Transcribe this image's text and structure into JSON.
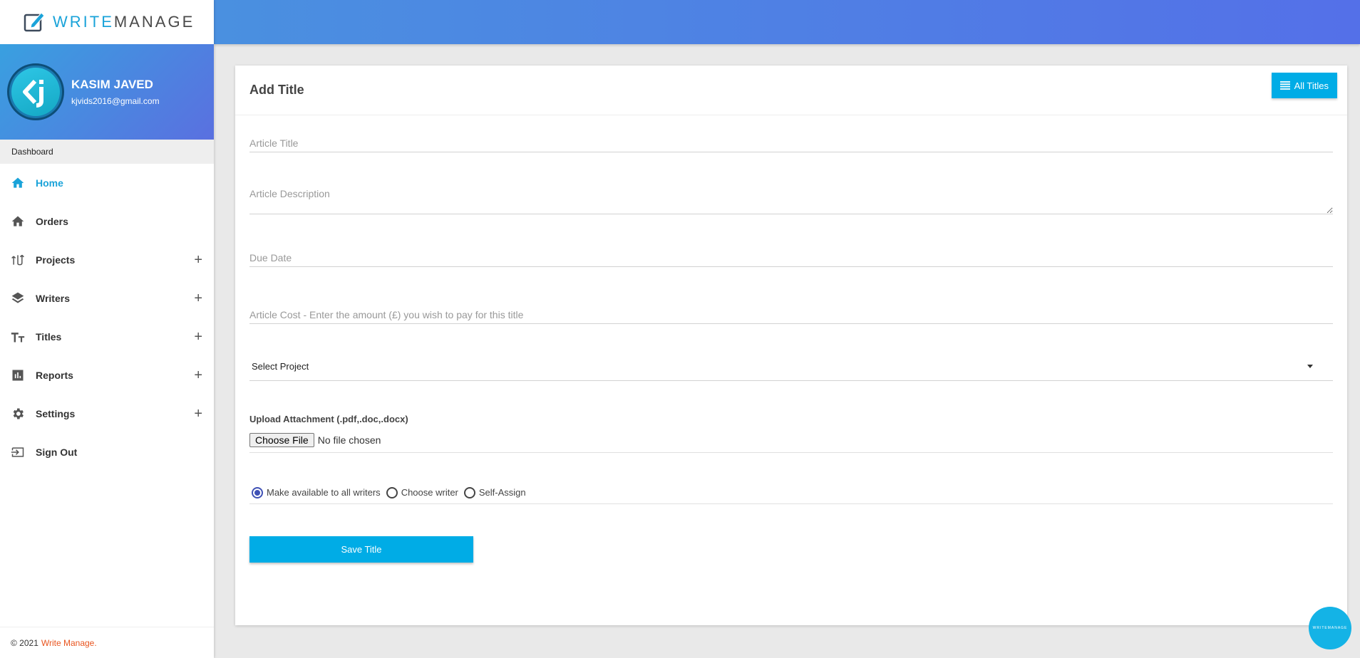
{
  "brand": {
    "logo_part1": "WRITE",
    "logo_part2": "MANAGE"
  },
  "user": {
    "name": "KASIM JAVED",
    "email": "kjvids2016@gmail.com"
  },
  "sidebar": {
    "section_label": "Dashboard",
    "items": [
      {
        "label": "Home",
        "icon": "home-icon",
        "active": true,
        "expandable": false
      },
      {
        "label": "Orders",
        "icon": "home-icon",
        "active": false,
        "expandable": false
      },
      {
        "label": "Projects",
        "icon": "swap-icon",
        "active": false,
        "expandable": true
      },
      {
        "label": "Writers",
        "icon": "layers-icon",
        "active": false,
        "expandable": true
      },
      {
        "label": "Titles",
        "icon": "text-size-icon",
        "active": false,
        "expandable": true
      },
      {
        "label": "Reports",
        "icon": "bar-chart-icon",
        "active": false,
        "expandable": true
      },
      {
        "label": "Settings",
        "icon": "gear-icon",
        "active": false,
        "expandable": true
      },
      {
        "label": "Sign Out",
        "icon": "sign-out-icon",
        "active": false,
        "expandable": false
      }
    ],
    "plus_glyph": "+"
  },
  "footer": {
    "copyright": "© 2021",
    "brand": "Write Manage."
  },
  "card": {
    "title": "Add Title",
    "all_titles_label": "All Titles"
  },
  "form": {
    "article_title_placeholder": "Article Title",
    "article_description_placeholder": "Article Description",
    "due_date_placeholder": "Due Date",
    "article_cost_placeholder": "Article Cost - Enter the amount (£) you wish to pay for this title",
    "select_project_label": "Select Project",
    "upload_label": "Upload Attachment (.pdf,.doc,.docx)",
    "choose_file_label": "Choose File",
    "no_file_label": "No file chosen",
    "radio_options": [
      {
        "label": "Make available to all writers",
        "checked": true
      },
      {
        "label": "Choose writer",
        "checked": false
      },
      {
        "label": "Self-Assign",
        "checked": false
      }
    ],
    "save_label": "Save Title"
  },
  "fab": {
    "label": "WRITEMANAGE"
  },
  "colors": {
    "accent": "#00ace6",
    "brand_orange": "#e8541e",
    "radio": "#3f51b5"
  }
}
